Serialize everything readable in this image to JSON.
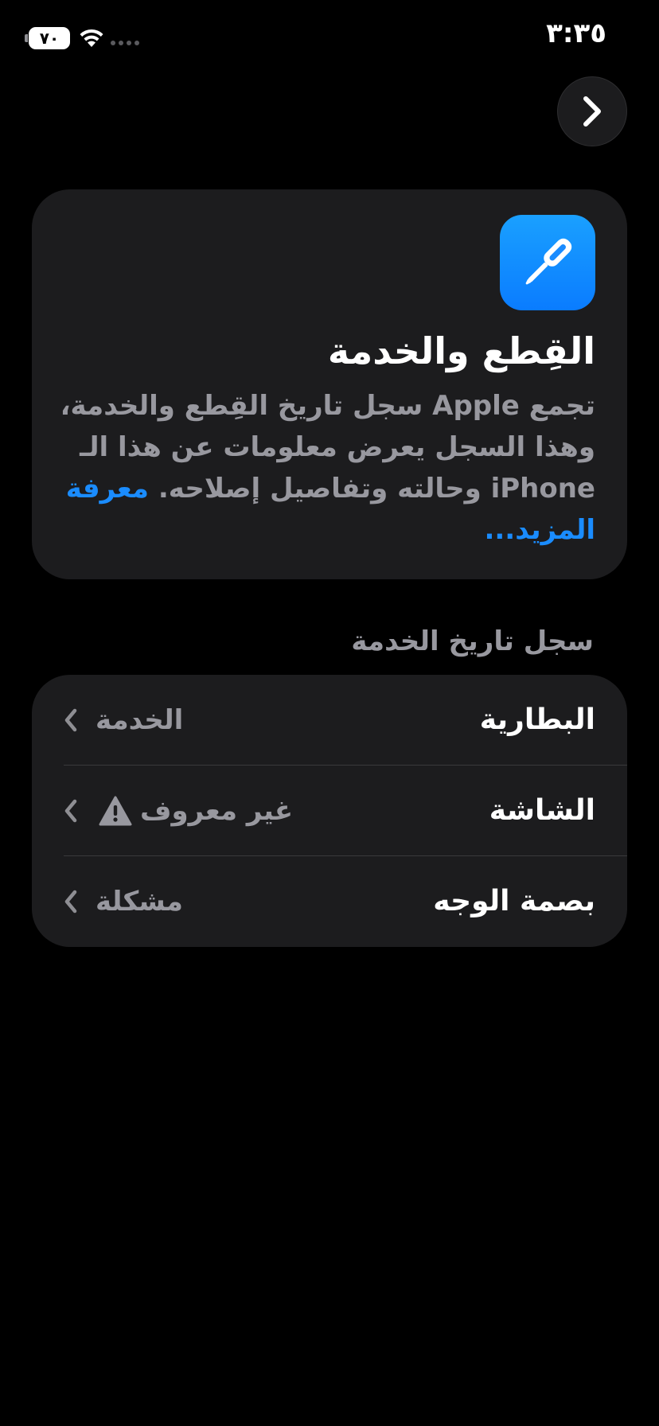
{
  "status_bar": {
    "time": "٣:٣٥",
    "battery": "٧٠"
  },
  "header": {
    "title": "القِطع والخدمة",
    "description": "تجمع Apple سجل تاريخ القِطع والخدمة، وهذا السجل يعرض معلومات عن هذا الـ iPhone وحالته وتفاصيل إصلاحه.",
    "learn_more": "معرفة المزيد..."
  },
  "service_history": {
    "section_title": "سجل تاريخ الخدمة",
    "rows": [
      {
        "label": "البطارية",
        "value": "الخدمة"
      },
      {
        "label": "الشاشة",
        "value": "غير معروف"
      },
      {
        "label": "بصمة الوجه",
        "value": "مشكلة"
      }
    ]
  },
  "icons": {
    "back": "chevron-right-icon",
    "app": "screwdriver-icon",
    "row_chevron": "chevron-left-icon",
    "warning": "warning-triangle-icon",
    "wifi": "wifi-icon",
    "signal": "cellular-signal-icon"
  },
  "colors": {
    "background": "#000000",
    "card": "#1c1c1e",
    "secondary_text": "#98989f",
    "accent": "#1a8cff"
  }
}
